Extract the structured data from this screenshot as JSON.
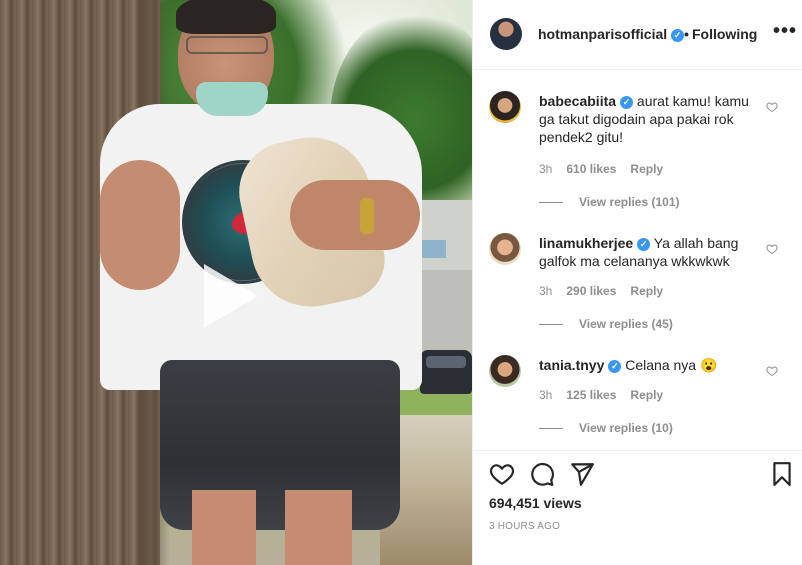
{
  "post": {
    "owner": "hotmanparisofficial",
    "verified_mark": "✓",
    "dot": "•",
    "follow_state": "Following",
    "more_icon": "more-horizontal-icon",
    "more_glyph": "•••",
    "media_type": "video",
    "views": "694,451 views",
    "time_ago": "3 HOURS AGO"
  },
  "comments": [
    {
      "user": "babecabiita",
      "text": " aurat kamu! kamu ga takut digodain apa pakai rok pendek2 gitu!",
      "time": "3h",
      "likes": "610 likes",
      "reply": "Reply",
      "view_replies": "View replies (101)"
    },
    {
      "user": "linamukherjee",
      "text": " Ya allah bang galfok ma celananya wkkwkwk",
      "time": "3h",
      "likes": "290 likes",
      "reply": "Reply",
      "view_replies": "View replies (45)"
    },
    {
      "user": "tania.tnyy",
      "text": " Celana nya 😮",
      "time": "3h",
      "likes": "125 likes",
      "reply": "Reply",
      "view_replies": "View replies (10)"
    }
  ],
  "actions": {
    "like_icon": "heart-icon",
    "comment_icon": "comment-icon",
    "share_icon": "share-icon",
    "save_icon": "bookmark-icon"
  },
  "colors": {
    "text": "#262626",
    "muted": "#8e8e8e",
    "verified": "#3897f0",
    "border": "#efefef"
  }
}
